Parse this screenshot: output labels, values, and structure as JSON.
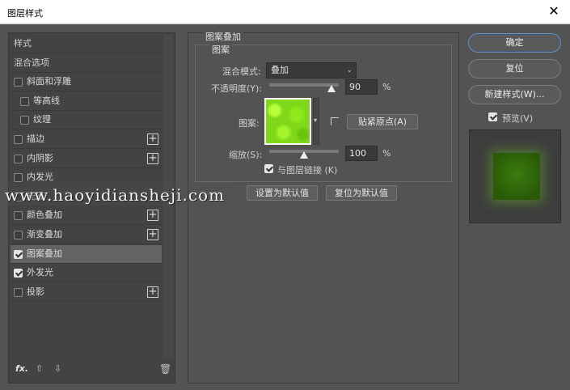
{
  "window": {
    "title": "图层样式",
    "close": "✕"
  },
  "left_panel": {
    "items": [
      {
        "label": "样式",
        "type": "header"
      },
      {
        "label": "混合选项",
        "type": "header"
      },
      {
        "label": "斜面和浮雕",
        "checked": false,
        "plus": false
      },
      {
        "label": "等高线",
        "checked": false,
        "plus": false,
        "indent": true
      },
      {
        "label": "纹理",
        "checked": false,
        "plus": false,
        "indent": true
      },
      {
        "label": "描边",
        "checked": false,
        "plus": true
      },
      {
        "label": "内阴影",
        "checked": false,
        "plus": true
      },
      {
        "label": "内发光",
        "checked": false,
        "plus": false
      },
      {
        "label": "光泽",
        "checked": false,
        "plus": false
      },
      {
        "label": "颜色叠加",
        "checked": false,
        "plus": true
      },
      {
        "label": "渐变叠加",
        "checked": false,
        "plus": true
      },
      {
        "label": "图案叠加",
        "checked": true,
        "plus": false,
        "selected": true
      },
      {
        "label": "外发光",
        "checked": true,
        "plus": false
      },
      {
        "label": "投影",
        "checked": false,
        "plus": true
      }
    ],
    "footer": {
      "fx": "fx.",
      "up": "⇧",
      "down": "⇩",
      "trash": "🗑"
    }
  },
  "center_panel": {
    "group_title": "图案叠加",
    "sub_title": "图案",
    "blend_mode": {
      "label": "混合模式:",
      "value": "叠加"
    },
    "opacity": {
      "label": "不透明度(Y):",
      "value": "90",
      "unit": "%",
      "level": 0.9
    },
    "pattern": {
      "label": "图案:",
      "snap_button": "贴紧原点(A)"
    },
    "scale": {
      "label": "缩放(S):",
      "value": "100",
      "unit": "%",
      "level": 0.5
    },
    "link": {
      "label": "与图层链接 (K)",
      "checked": true
    },
    "set_default": "设置为默认值",
    "reset_default": "复位为默认值"
  },
  "right_panel": {
    "ok": "确定",
    "reset": "复位",
    "new_style": "新建样式(W)...",
    "preview": {
      "label": "预览(V)",
      "checked": true
    }
  },
  "watermark": "www.haoyidiansheji.com",
  "colors": {
    "pattern_green": "#7fd81a",
    "preview_green": "#3a7d0e",
    "accent_blue": "#6f8fb8"
  }
}
